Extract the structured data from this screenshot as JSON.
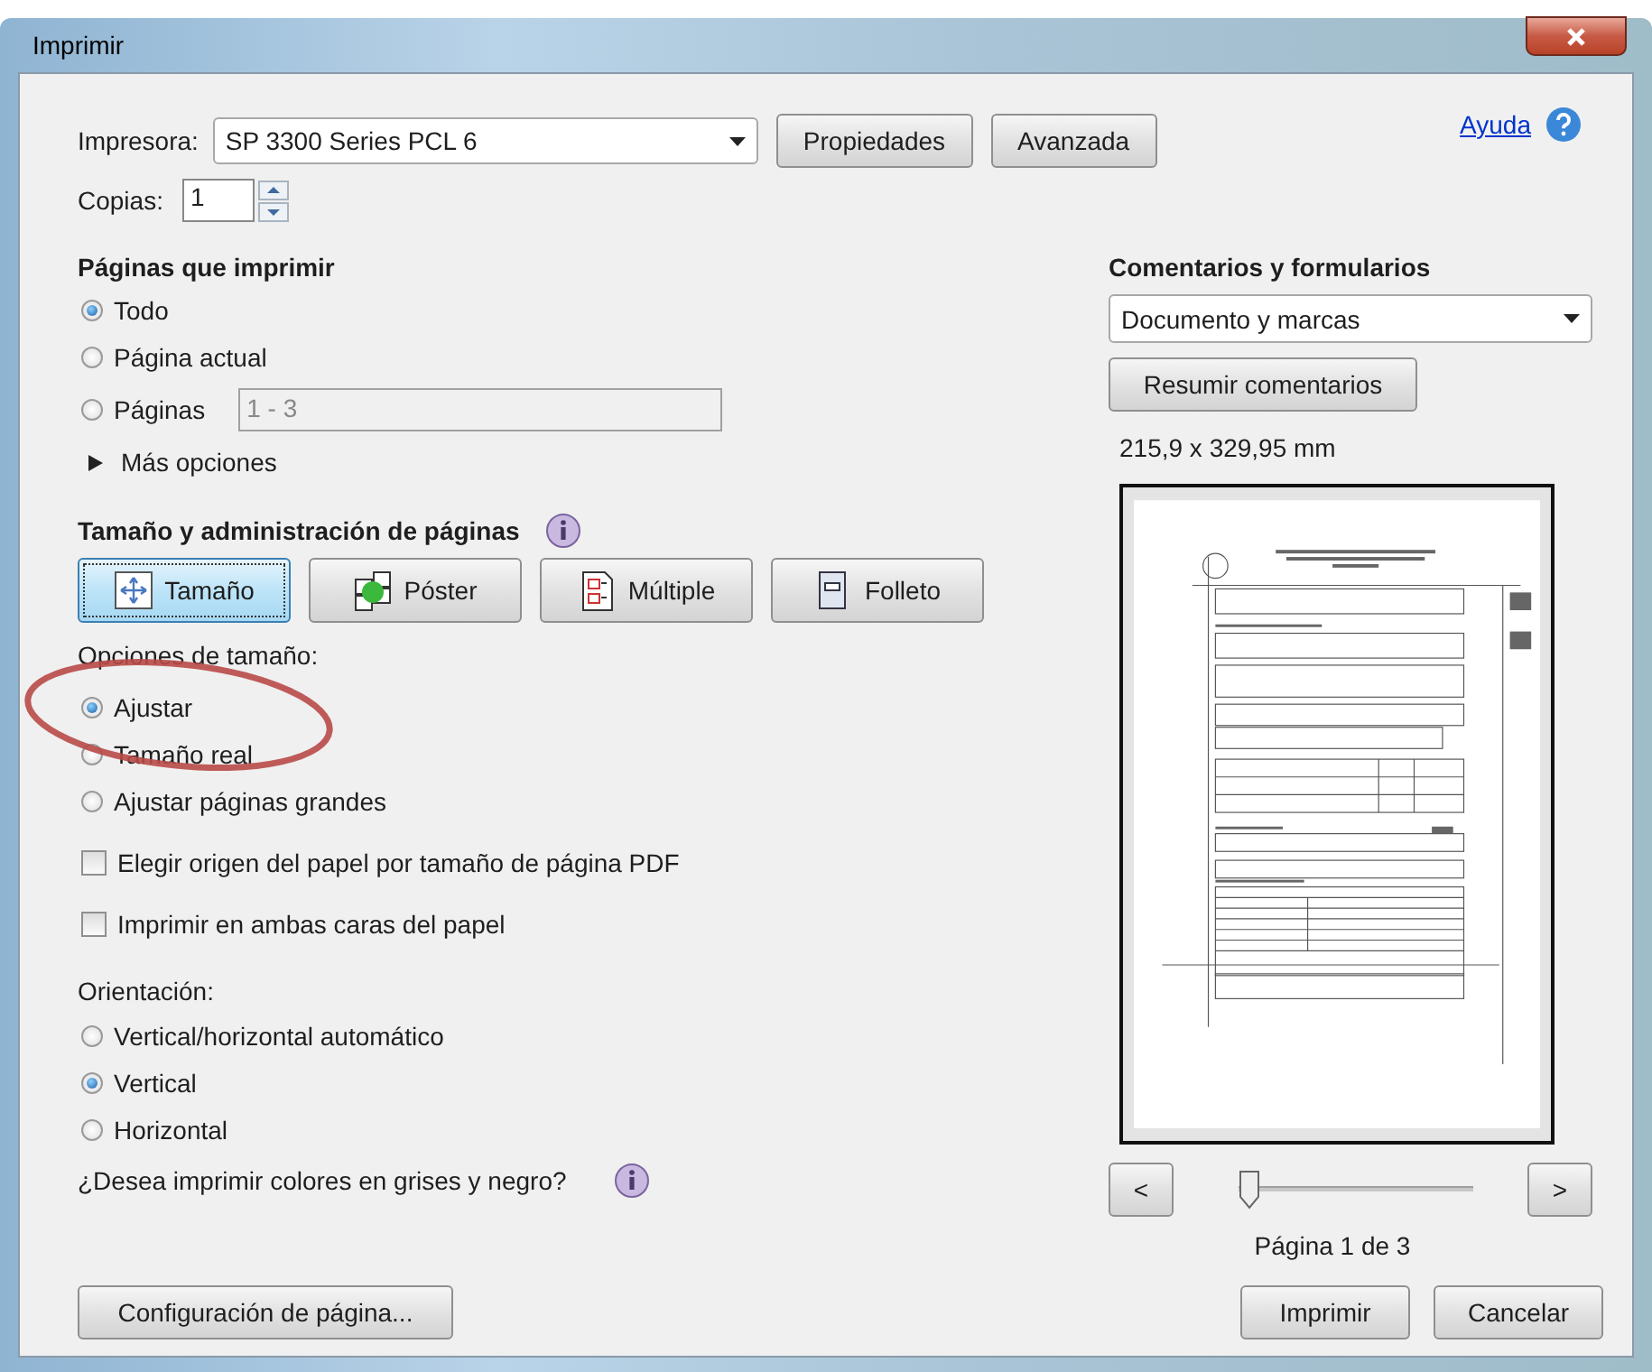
{
  "window": {
    "title": "Imprimir"
  },
  "printer": {
    "label": "Impresora:",
    "value": "SP 3300 Series PCL 6"
  },
  "top_buttons": [
    {
      "label": "Propiedades"
    },
    {
      "label": "Avanzada"
    }
  ],
  "help": {
    "label": "Ayuda"
  },
  "copies": {
    "label": "Copias:",
    "value": "1"
  },
  "pages_section": {
    "heading": "Páginas que imprimir",
    "options": [
      {
        "label": "Todo",
        "selected": true,
        "kind": "plain"
      },
      {
        "label": "Página actual",
        "selected": false,
        "kind": "plain"
      },
      {
        "label": "Páginas",
        "selected": false,
        "kind": "range",
        "value": "1 - 3",
        "disabled": true
      }
    ],
    "more": {
      "label": "Más opciones",
      "expanded": false
    }
  },
  "size_section": {
    "heading": "Tamaño y administración de páginas",
    "modes": [
      {
        "label": "Tamaño",
        "selected": true,
        "kind": "size"
      },
      {
        "label": "Póster",
        "selected": false,
        "kind": "poster"
      },
      {
        "label": "Múltiple",
        "selected": false,
        "kind": "multiple"
      },
      {
        "label": "Folleto",
        "selected": false,
        "kind": "booklet"
      }
    ],
    "options_label": "Opciones de tamaño:",
    "options": [
      {
        "label": "Ajustar",
        "selected": true
      },
      {
        "label": "Tamaño real",
        "selected": false
      },
      {
        "label": "Ajustar páginas grandes",
        "selected": false
      }
    ],
    "checkboxes": [
      {
        "label": "Elegir origen del papel por tamaño de página PDF",
        "checked": false
      },
      {
        "label": "Imprimir en ambas caras del papel",
        "checked": false
      }
    ]
  },
  "orientation": {
    "label": "Orientación:",
    "options": [
      {
        "label": "Vertical/horizontal automático",
        "selected": false
      },
      {
        "label": "Vertical",
        "selected": true
      },
      {
        "label": "Horizontal",
        "selected": false
      }
    ]
  },
  "grayscale": {
    "label": "¿Desea imprimir colores en grises y negro?"
  },
  "page_setup_button": {
    "label": "Configuración de página..."
  },
  "comments": {
    "heading": "Comentarios y formularios",
    "value": "Documento y marcas",
    "summarize": "Resumir comentarios"
  },
  "preview": {
    "dimensions": "215,9 x 329,95 mm",
    "prev": "<",
    "next": ">",
    "slider": {
      "level": 0
    },
    "page_label": "Página 1 de 3"
  },
  "buttons": [
    {
      "label": "Imprimir"
    },
    {
      "label": "Cancelar"
    }
  ],
  "annotation": {
    "kind": "ellipse"
  }
}
